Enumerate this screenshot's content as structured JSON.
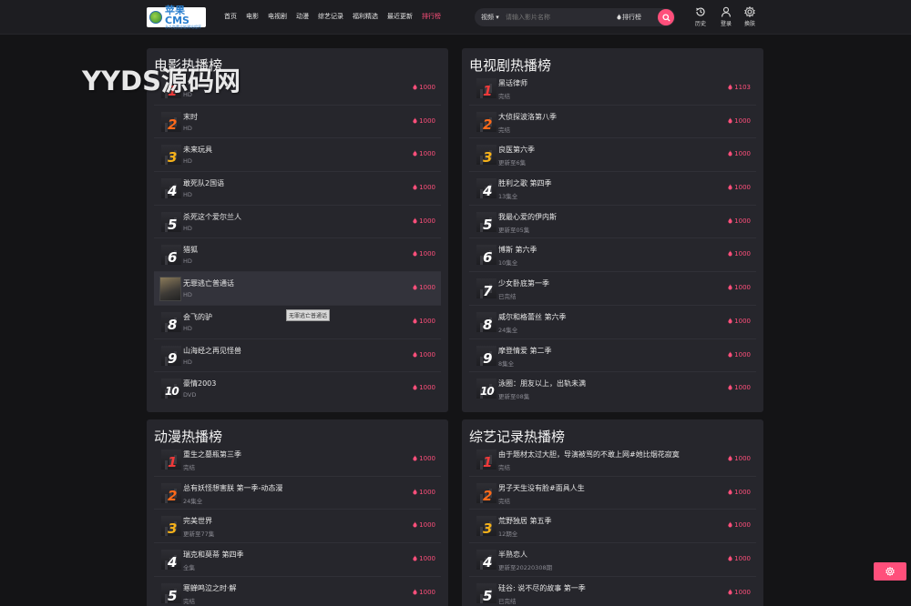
{
  "logo": {
    "main": "苹果CMS",
    "sub": "永久免费全能建站程序"
  },
  "nav": {
    "items": [
      {
        "label": "首页",
        "active": false
      },
      {
        "label": "电影",
        "active": false
      },
      {
        "label": "电视剧",
        "active": false
      },
      {
        "label": "动漫",
        "active": false
      },
      {
        "label": "综艺记录",
        "active": false
      },
      {
        "label": "福利精选",
        "active": false
      },
      {
        "label": "最近更新",
        "active": false
      },
      {
        "label": "排行榜",
        "active": true
      }
    ]
  },
  "search": {
    "type_label": "视频 ▾",
    "placeholder": "请输入影片名称",
    "rank_label": "排行榜"
  },
  "tools": {
    "history": "历史",
    "login": "登录",
    "skin": "换肤"
  },
  "colors": {
    "accent": "#ff4f7b",
    "rank1": "#ee3a3a",
    "rank2": "#ff6a1a",
    "rank3": "#f6b21a"
  },
  "watermark": "YYDS源码网",
  "tooltip": "无罪逃亡普通话",
  "panels": [
    {
      "title": "电影热播榜",
      "items": [
        {
          "rank": "1",
          "name": "",
          "sub": "HD",
          "hot": "1000"
        },
        {
          "rank": "2",
          "name": "末时",
          "sub": "HD",
          "hot": "1000"
        },
        {
          "rank": "3",
          "name": "未来玩具",
          "sub": "HD",
          "hot": "1000"
        },
        {
          "rank": "4",
          "name": "敢死队2国语",
          "sub": "HD",
          "hot": "1000"
        },
        {
          "rank": "5",
          "name": "杀死这个爱尔兰人",
          "sub": "HD",
          "hot": "1000"
        },
        {
          "rank": "6",
          "name": "猎狐",
          "sub": "HD",
          "hot": "1000"
        },
        {
          "rank": "7",
          "name": "无罪逃亡普通话",
          "sub": "HD",
          "hot": "1000"
        },
        {
          "rank": "8",
          "name": "会飞的驴",
          "sub": "HD",
          "hot": "1000"
        },
        {
          "rank": "9",
          "name": "山海经之再见怪兽",
          "sub": "HD",
          "hot": "1000"
        },
        {
          "rank": "10",
          "name": "豪情2003",
          "sub": "DVD",
          "hot": "1000"
        }
      ]
    },
    {
      "title": "电视剧热播榜",
      "items": [
        {
          "rank": "1",
          "name": "黑话律师",
          "sub": "完结",
          "hot": "1103"
        },
        {
          "rank": "2",
          "name": "大侦探波洛第八季",
          "sub": "完结",
          "hot": "1000"
        },
        {
          "rank": "3",
          "name": "良医第六季",
          "sub": "更新至6集",
          "hot": "1000"
        },
        {
          "rank": "4",
          "name": "胜利之歌 第四季",
          "sub": "13集全",
          "hot": "1000"
        },
        {
          "rank": "5",
          "name": "我最心爱的伊内斯",
          "sub": "更新至05集",
          "hot": "1000"
        },
        {
          "rank": "6",
          "name": "博斯 第六季",
          "sub": "10集全",
          "hot": "1000"
        },
        {
          "rank": "7",
          "name": "少女卧底第一季",
          "sub": "已完结",
          "hot": "1000"
        },
        {
          "rank": "8",
          "name": "威尔和格蕾丝 第六季",
          "sub": "24集全",
          "hot": "1000"
        },
        {
          "rank": "9",
          "name": "摩登情爱 第二季",
          "sub": "8集全",
          "hot": "1000"
        },
        {
          "rank": "10",
          "name": "泳圈：朋友以上，出轨未满",
          "sub": "更新至08集",
          "hot": "1000"
        }
      ]
    },
    {
      "title": "动漫热播榜",
      "items": [
        {
          "rank": "1",
          "name": "重生之墓瓶第三季",
          "sub": "完结",
          "hot": "1000"
        },
        {
          "rank": "2",
          "name": "总有妖怪想害朕 第一季-动态漫",
          "sub": "24集全",
          "hot": "1000"
        },
        {
          "rank": "3",
          "name": "完美世界",
          "sub": "更新至77集",
          "hot": "1000"
        },
        {
          "rank": "4",
          "name": "瑞克和莫蒂 第四季",
          "sub": "全集",
          "hot": "1000"
        },
        {
          "rank": "5",
          "name": "寒蝉鸣泣之时·解",
          "sub": "完结",
          "hot": "1000"
        }
      ]
    },
    {
      "title": "综艺记录热播榜",
      "items": [
        {
          "rank": "1",
          "name": "由于题材太过大胆，导演被骂的不敢上网#她比烟花寂寞",
          "sub": "完结",
          "hot": "1000"
        },
        {
          "rank": "2",
          "name": "男子天生没有脸#面具人生",
          "sub": "完结",
          "hot": "1000"
        },
        {
          "rank": "3",
          "name": "荒野独居 第五季",
          "sub": "12期全",
          "hot": "1000"
        },
        {
          "rank": "4",
          "name": "半熟恋人",
          "sub": "更新至20220308期",
          "hot": "1000"
        },
        {
          "rank": "5",
          "name": "硅谷: 说不尽的故事 第一季",
          "sub": "已完结",
          "hot": "1000"
        }
      ]
    }
  ]
}
